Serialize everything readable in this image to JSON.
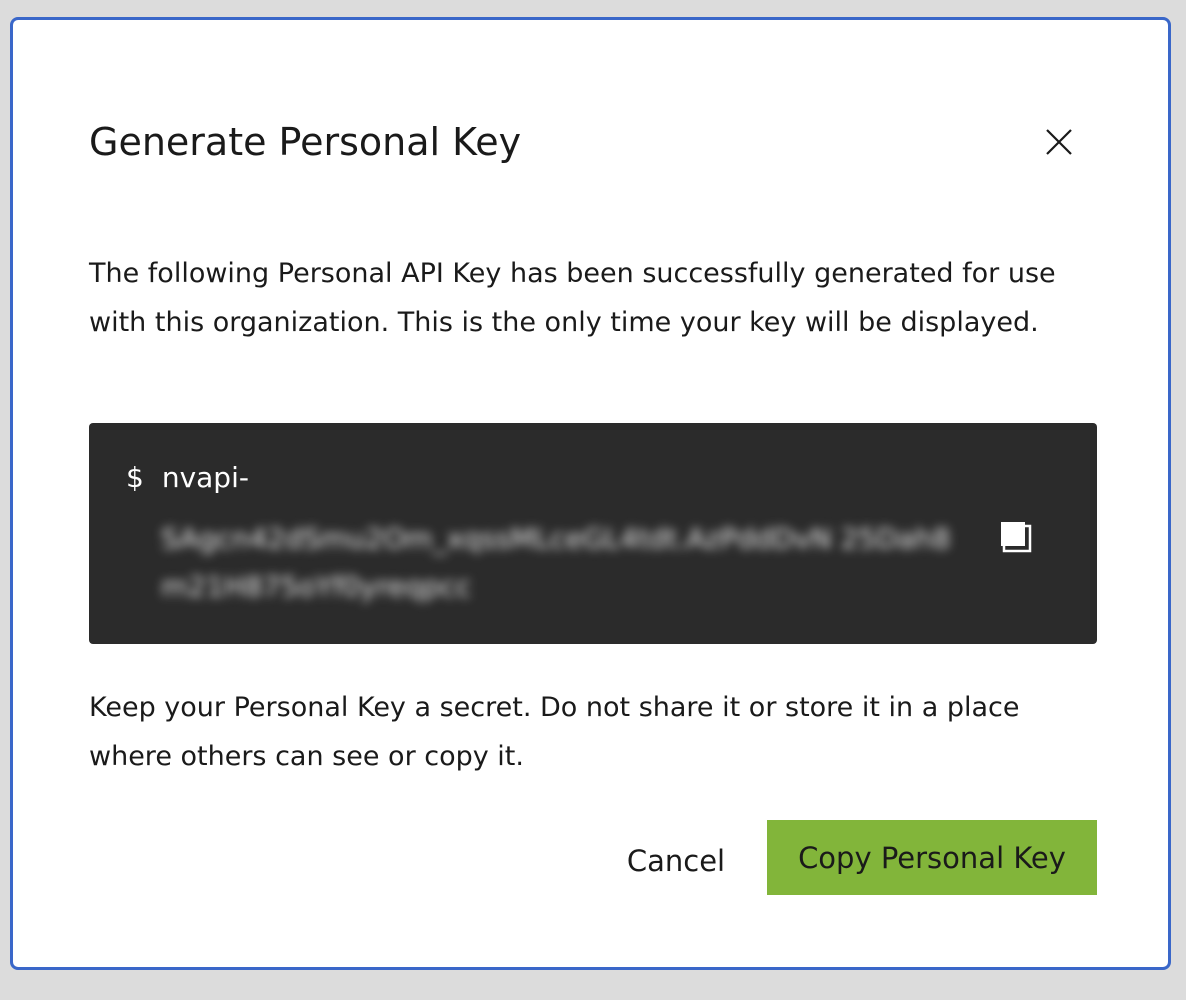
{
  "dialog": {
    "title": "Generate Personal Key",
    "description": "The following Personal API Key has been successfully generated for use with this organization. This is the only time your key will be displayed.",
    "key": {
      "prompt": "$",
      "prefix": "nvapi-",
      "secret": "SAgcn42dSmu2Om_xqssMLceGL4tdt.AzPddDvN 25Dah8m21H875oYf0yreqpcc"
    },
    "warning": "Keep your Personal Key a secret. Do not share it or store it in a place where others can see or copy it.",
    "buttons": {
      "cancel": "Cancel",
      "copy": "Copy Personal Key"
    },
    "colors": {
      "primary_button": "#82b53a",
      "key_box_background": "#2b2b2b",
      "dialog_border": "#3a67c9"
    },
    "icons": {
      "close": "close-icon",
      "copy": "copy-icon"
    }
  }
}
